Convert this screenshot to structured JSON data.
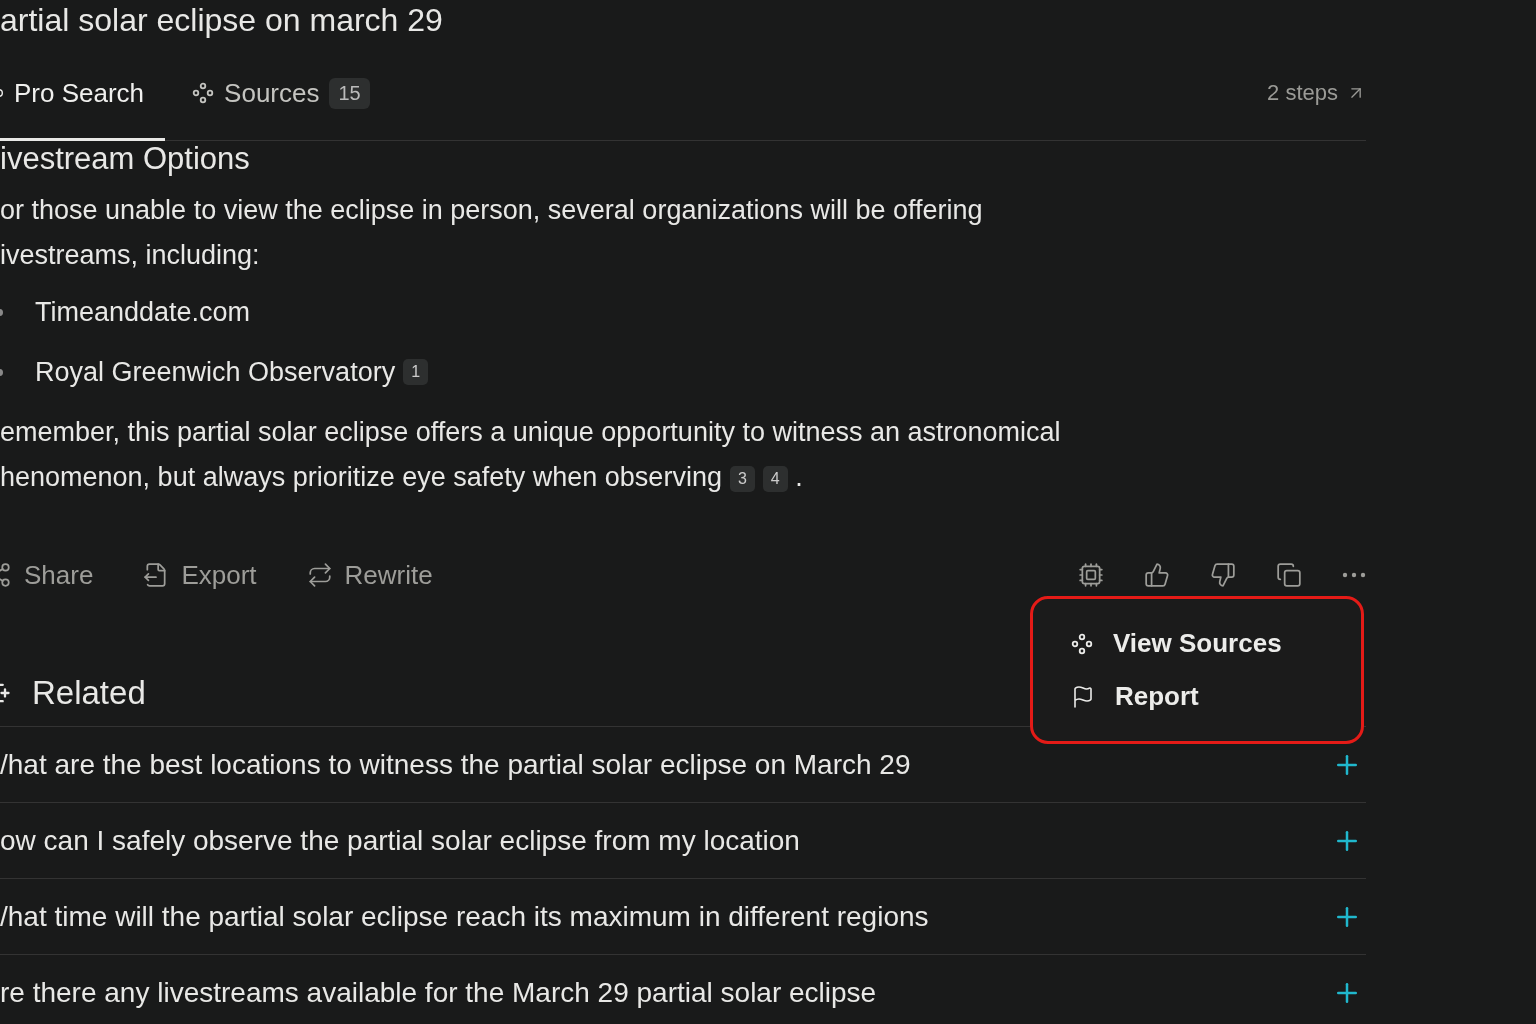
{
  "title": "artial solar eclipse on march 29",
  "tabs": [
    {
      "label": "Pro Search",
      "kind": "pro",
      "selected": true
    },
    {
      "label": "Sources",
      "kind": "sources",
      "count": "15",
      "selected": false
    }
  ],
  "steps": "2 steps",
  "section_heading": "ivestream Options",
  "intro": "or those unable to view the eclipse in person, several organizations will be offering ivestreams, including:",
  "bullets": [
    {
      "text": "Timeanddate.com"
    },
    {
      "text": "Royal Greenwich Observatory",
      "citations": [
        "1"
      ]
    }
  ],
  "closing": {
    "text": "emember, this partial solar eclipse offers a unique opportunity to witness an astronomical henomenon, but always prioritize eye safety when observing",
    "citations": [
      "3",
      "4"
    ],
    "end": "."
  },
  "actions": [
    {
      "label": "Share",
      "kind": "share"
    },
    {
      "label": "Export",
      "kind": "export"
    },
    {
      "label": "Rewrite",
      "kind": "rewrite"
    }
  ],
  "tools": [
    {
      "kind": "chip"
    },
    {
      "kind": "up"
    },
    {
      "kind": "down"
    },
    {
      "kind": "copy"
    },
    {
      "kind": "more"
    }
  ],
  "menu": [
    {
      "label": "View Sources",
      "kind": "sources"
    },
    {
      "label": "Report",
      "kind": "report"
    }
  ],
  "related_heading": "Related",
  "related": [
    "/hat are the best locations to witness the partial solar eclipse on March 29",
    "ow can I safely observe the partial solar eclipse from my location",
    "/hat time will the partial solar eclipse reach its maximum in different regions",
    "re there any livestreams available for the March 29 partial solar eclipse"
  ]
}
